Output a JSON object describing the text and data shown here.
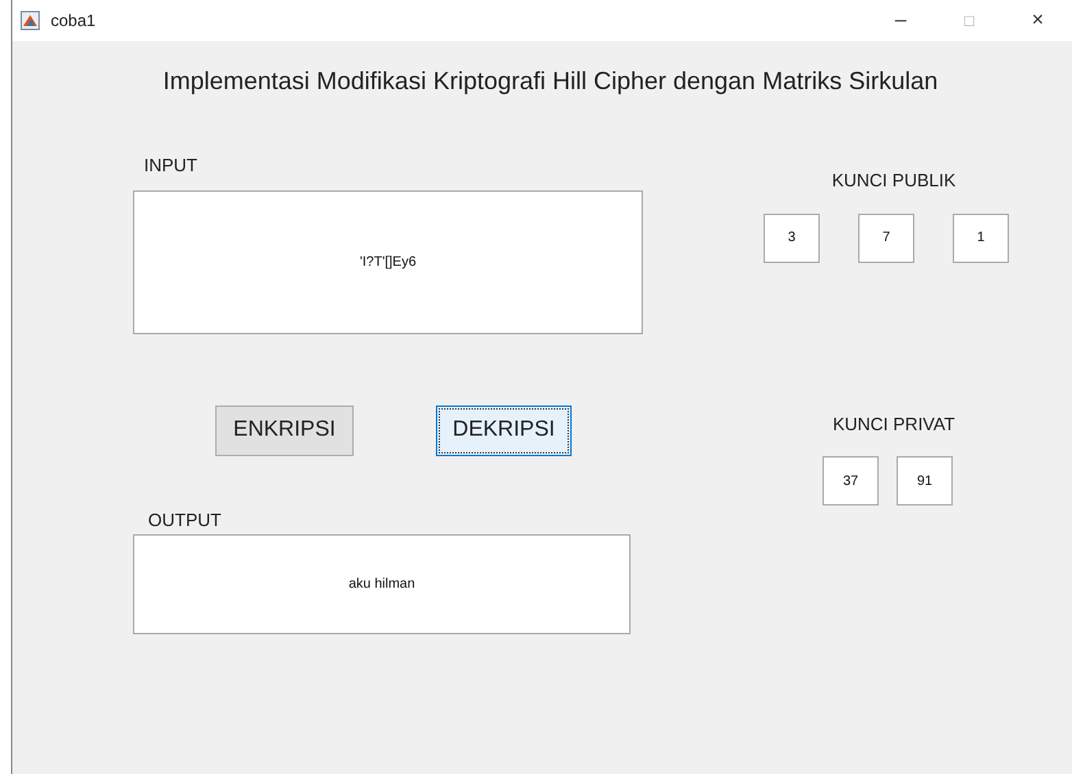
{
  "window": {
    "title": "coba1",
    "controls": [
      "–",
      "□",
      "×"
    ]
  },
  "heading": "Implementasi Modifikasi Kriptografi Hill Cipher dengan Matriks Sirkulan",
  "input": {
    "label": "INPUT",
    "value": "'I?T'[]Ey6"
  },
  "buttons": [
    {
      "label": "ENKRIPSI",
      "focused": false
    },
    {
      "label": "DEKRIPSI",
      "focused": true
    }
  ],
  "output": {
    "label": "OUTPUT",
    "value": "aku hilman"
  },
  "public_key": {
    "label": "KUNCI PUBLIK",
    "values": [
      "3",
      "7",
      "1"
    ]
  },
  "private_key": {
    "label": "KUNCI PRIVAT",
    "values": [
      "37",
      "91"
    ]
  }
}
